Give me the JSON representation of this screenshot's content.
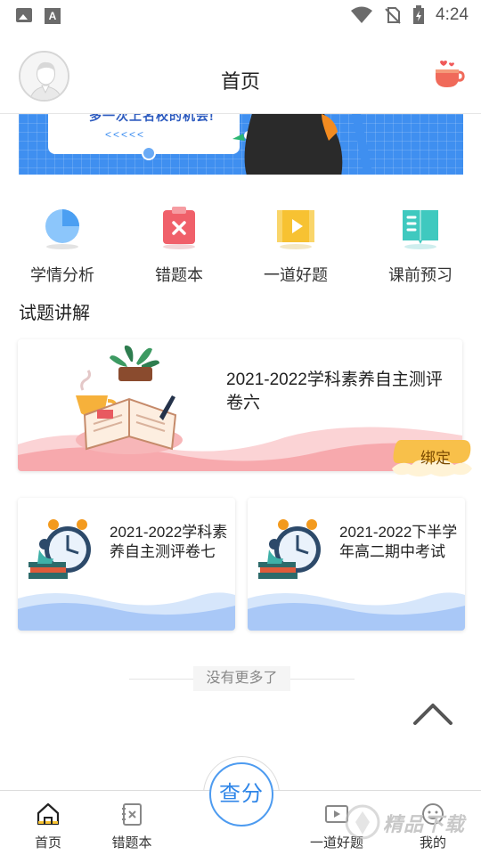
{
  "status_bar": {
    "time": "4:24"
  },
  "header": {
    "title": "首页"
  },
  "banner": {
    "text": "多一次上名校的机会!",
    "arrows": "<<<<<"
  },
  "quick_nav": [
    {
      "label": "学情分析",
      "icon": "pie-chart-icon",
      "color": "#5aa9f5"
    },
    {
      "label": "错题本",
      "icon": "clipboard-x-icon",
      "color": "#f0606a"
    },
    {
      "label": "一道好题",
      "icon": "video-play-icon",
      "color": "#f7c232"
    },
    {
      "label": "课前预习",
      "icon": "book-icon",
      "color": "#3fc9bf"
    }
  ],
  "section": {
    "title": "试题讲解"
  },
  "featured": {
    "title": "2021-2022学科素养自主测评卷六",
    "badge": "绑定"
  },
  "papers": [
    {
      "title": "2021-2022学科素养自主测评卷七"
    },
    {
      "title": "2021-2022下半学年高二期中考试"
    }
  ],
  "list_end": {
    "text": "没有更多了"
  },
  "bottom_nav": {
    "items": [
      {
        "label": "首页",
        "icon": "home-icon",
        "active": true
      },
      {
        "label": "错题本",
        "icon": "wrong-book-icon",
        "active": false
      },
      {
        "label": "一道好题",
        "icon": "video-icon",
        "active": false
      },
      {
        "label": "我的",
        "icon": "profile-icon",
        "active": false
      }
    ],
    "center_button": "查分"
  },
  "watermark": {
    "text": "精品下载"
  },
  "colors": {
    "accent": "#4d9bf0",
    "banner_blue": "#3f8ff0",
    "wave_pink": "#f7a9ad",
    "wave_blue": "#a9c8f7"
  }
}
